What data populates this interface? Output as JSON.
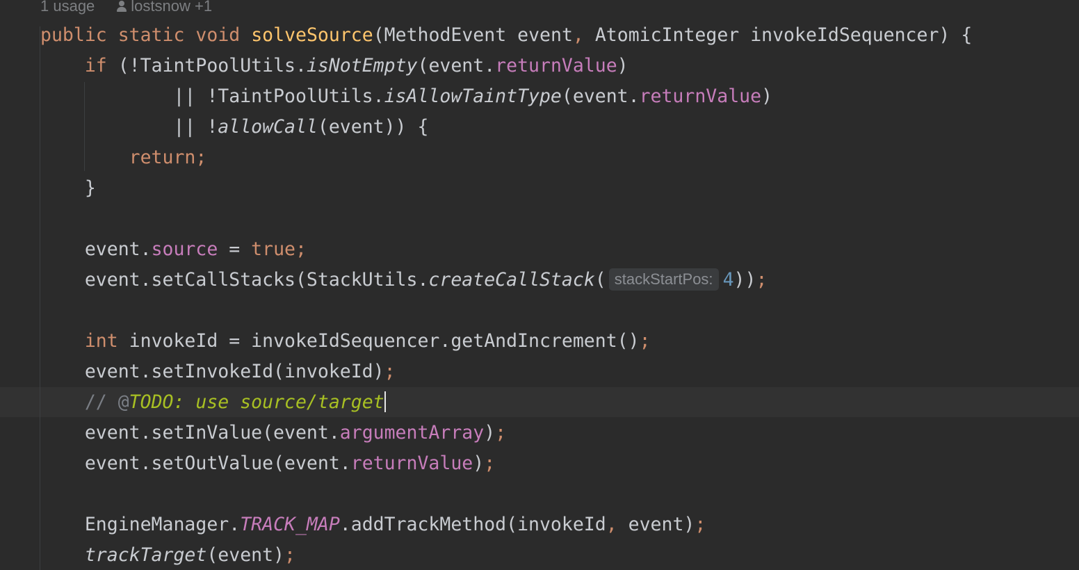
{
  "editor": {
    "language": "java",
    "inlay_usage": "1 usage",
    "inlay_author": "lostsnow +1",
    "current_line": 13,
    "lines": [
      "public static void solveSource(MethodEvent event, AtomicInteger invokeIdSequencer) {",
      "    if (!TaintPoolUtils.isNotEmpty(event.returnValue)",
      "            || !TaintPoolUtils.isAllowTaintType(event.returnValue)",
      "            || !allowCall(event)) {",
      "        return;",
      "    }",
      "",
      "    event.source = true;",
      "    event.setCallStacks(StackUtils.createCallStack( stackStartPos: 4));",
      "",
      "    int invokeId = invokeIdSequencer.getAndIncrement();",
      "    event.setInvokeId(invokeId);",
      "    // @TODO: use source/target",
      "    event.setInValue(event.argumentArray);",
      "    event.setOutValue(event.returnValue);",
      "",
      "    EngineManager.TRACK_MAP.addTrackMethod(invokeId, event);",
      "    trackTarget(event);"
    ]
  },
  "tok": {
    "kw_public": "public",
    "kw_static": "static",
    "kw_void": "void",
    "fn_solveSource": "solveSource",
    "p_open": "(",
    "p_close": ")",
    "p_closeclose": "))",
    "semi": ";",
    "comma": ",",
    "dot": ".",
    "space": " ",
    "eq": " = ",
    "t_MethodEvent_event": "MethodEvent event",
    "t_AtomicInteger_param": " AtomicInteger invokeIdSequencer) {",
    "kw_if": "if",
    "t_not_TaintPoolUtils": " (!TaintPoolUtils.",
    "m_isNotEmpty": "isNotEmpty",
    "t_event_dot_open": "(event.",
    "f_returnValue": "returnValue",
    "t_or_not_TaintPoolUtils": "|| !TaintPoolUtils.",
    "m_isAllowTaintType": "isAllowTaintType",
    "t_or_not": "|| !",
    "m_allowCall": "allowCall",
    "t_event_close_brace": "(event)) {",
    "kw_return": "return",
    "brace_close": "}",
    "t_event_dot": "event.",
    "f_source": "source",
    "kw_true": "true",
    "t_setCallStacks": "event.setCallStacks(StackUtils.",
    "m_createCallStack": "createCallStack",
    "inlay_stackStartPos": "stackStartPos:",
    "num_4": "4",
    "kw_int": "int",
    "t_invokeId_assign": " invokeId = invokeIdSequencer.getAndIncrement()",
    "t_setInvokeId": "event.setInvokeId(invokeId)",
    "cmt_prefix": "// @",
    "todo_text": "TODO: use source/target",
    "t_setInValue": "event.setInValue(event.",
    "f_argumentArray": "argumentArray",
    "t_setOutValue": "event.setOutValue(event.",
    "t_EngineManager": "EngineManager.",
    "c_TRACK_MAP": "TRACK_MAP",
    "t_addTrackMethod": ".addTrackMethod(invokeId",
    "t_event_paren": " event)",
    "m_trackTarget": "trackTarget",
    "t_event_arg": "(event)"
  }
}
